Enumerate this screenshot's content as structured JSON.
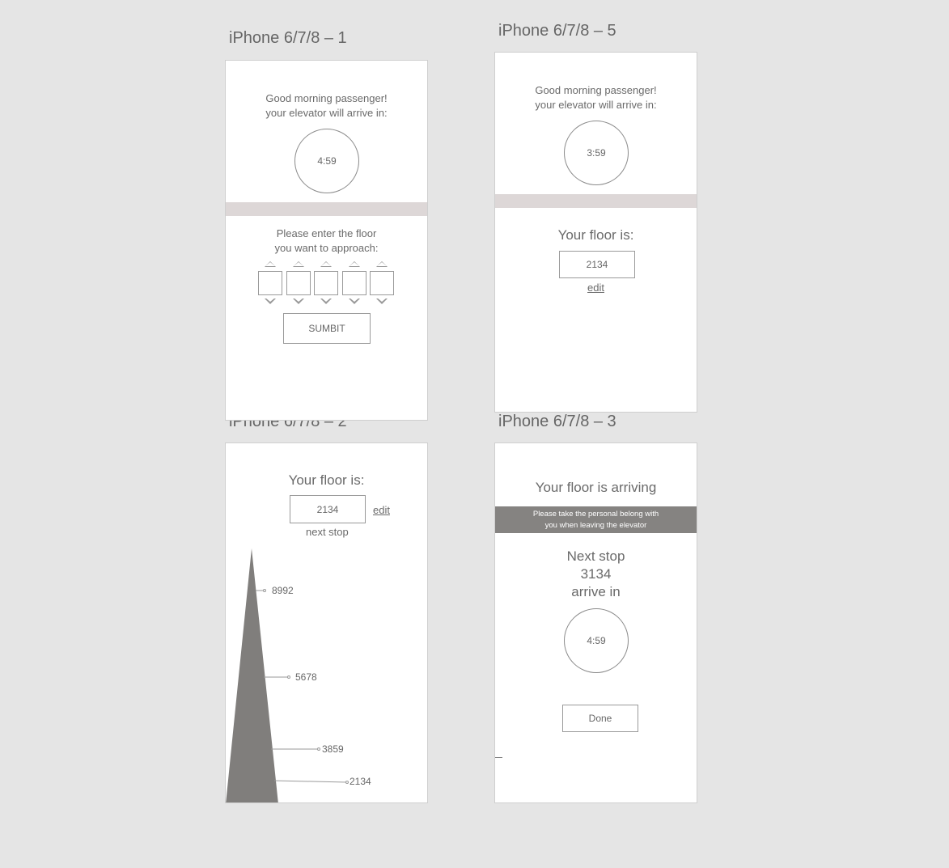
{
  "artboards": {
    "a1": "iPhone 6/7/8 – 1",
    "a5": "iPhone 6/7/8 – 5",
    "a2": "iPhone 6/7/8 – 2",
    "a3": "iPhone 6/7/8 – 3"
  },
  "screen1": {
    "greeting_line1": "Good morning passenger!",
    "greeting_line2": "your elevator will arrive in:",
    "countdown": "4:59",
    "prompt_line1": "Please enter the floor",
    "prompt_line2": "you want to approach:",
    "submit_label": "SUMBIT"
  },
  "screen5": {
    "greeting_line1": "Good morning passenger!",
    "greeting_line2": "your elevator will arrive in:",
    "countdown": "3:59",
    "floor_heading": "Your floor is:",
    "floor_value": "2134",
    "edit_label": "edit"
  },
  "screen2": {
    "floor_heading": "Your floor is:",
    "floor_value": "2134",
    "edit_label": "edit",
    "next_stop_label": "next stop",
    "stops": [
      "8992",
      "5678",
      "3859",
      "2134"
    ]
  },
  "screen3": {
    "heading": "Your floor is arriving",
    "notice_line1": "Please take the personal belong with",
    "notice_line2": "you when leaving the elevator",
    "next_stop_label": "Next stop",
    "next_stop_value": "3134",
    "arrive_label": "arrive in",
    "countdown": "4:59",
    "done_label": "Done"
  },
  "colors": {
    "background": "#e5e5e5",
    "screen": "#ffffff",
    "divider": "#ddd7d7",
    "notice_bar": "#858381",
    "shaft": "#807e7c"
  }
}
